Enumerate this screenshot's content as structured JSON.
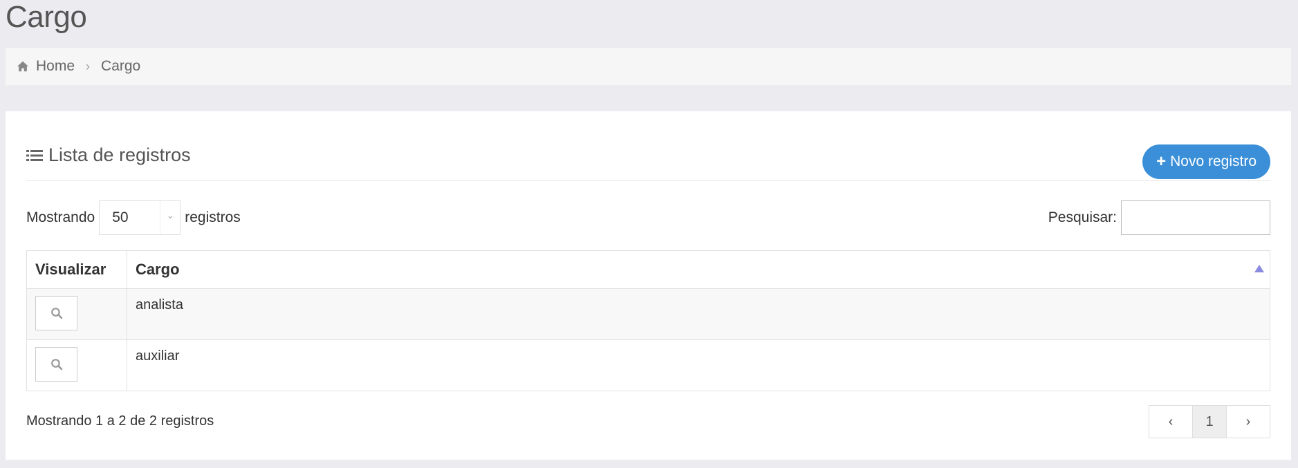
{
  "page": {
    "title": "Cargo"
  },
  "breadcrumb": {
    "home": "Home",
    "current": "Cargo"
  },
  "panel": {
    "title": "Lista de registros",
    "new_button": "Novo registro"
  },
  "length": {
    "prefix": "Mostrando",
    "value": "50",
    "suffix": "registros"
  },
  "search": {
    "label": "Pesquisar:",
    "value": ""
  },
  "table": {
    "columns": [
      "Visualizar",
      "Cargo"
    ],
    "rows": [
      {
        "cargo": "analista"
      },
      {
        "cargo": "auxiliar"
      }
    ]
  },
  "info": "Mostrando 1 a 2 de 2 registros",
  "pagination": {
    "current": "1"
  },
  "colors": {
    "accent": "#3a8fd8",
    "sort": "#8a8ae0",
    "background": "#ebebf0"
  },
  "icons": [
    "home-icon",
    "chevron-right-icon",
    "list-icon",
    "plus-icon",
    "chevron-down-icon",
    "sort-asc-icon",
    "search-icon",
    "chevron-left-icon"
  ]
}
